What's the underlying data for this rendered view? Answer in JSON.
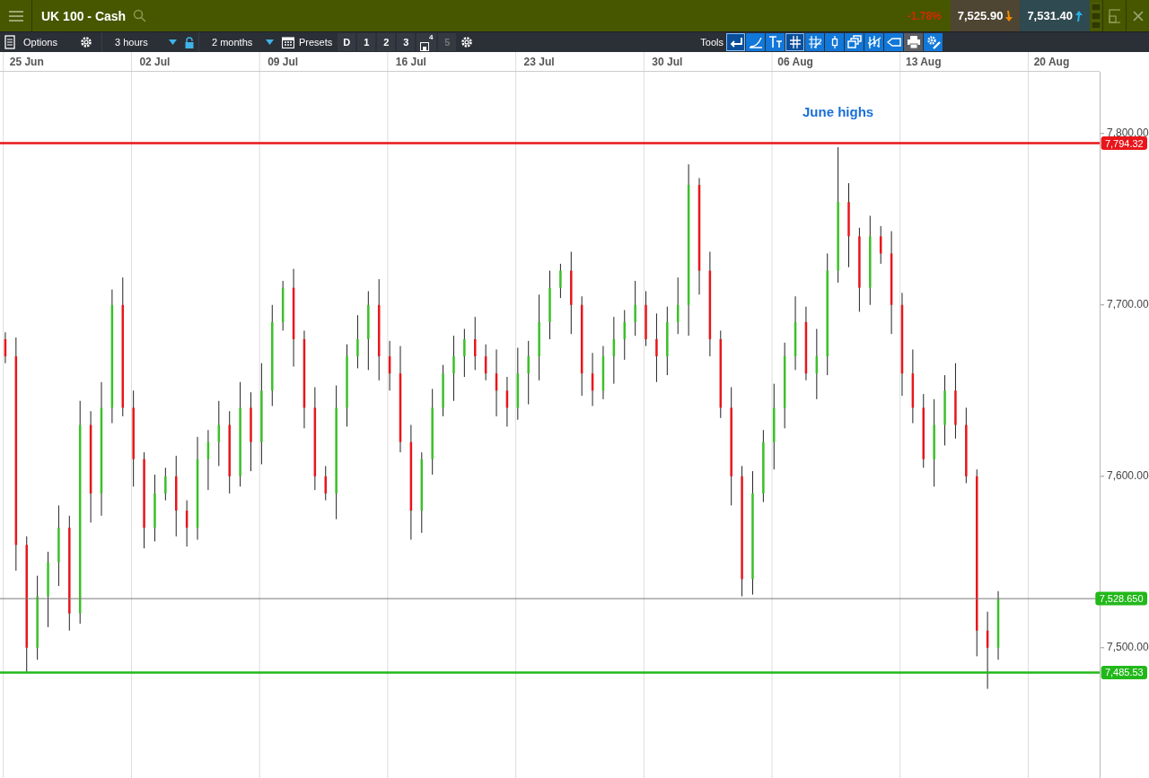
{
  "header": {
    "title": "UK 100 - Cash",
    "change": "-1.78%",
    "sell": {
      "price": "7,525.90"
    },
    "buy": {
      "price": "7,531.40"
    }
  },
  "toolbar": {
    "options_label": "Options",
    "interval": "3 hours",
    "range": "2 months",
    "presets_label": "Presets",
    "presets": [
      {
        "label": "D",
        "kind": "text",
        "disabled": false
      },
      {
        "label": "1",
        "kind": "text",
        "disabled": false
      },
      {
        "label": "2",
        "kind": "text",
        "disabled": false
      },
      {
        "label": "3",
        "kind": "text",
        "disabled": false
      },
      {
        "label": "4",
        "kind": "save",
        "disabled": false
      },
      {
        "label": "5",
        "kind": "text",
        "disabled": true
      }
    ],
    "tools_label": "Tools",
    "tools": [
      {
        "kind": "back",
        "selected": true
      },
      {
        "kind": "curve",
        "selected": false
      },
      {
        "kind": "text",
        "selected": false
      },
      {
        "kind": "parallel",
        "selected": true
      },
      {
        "kind": "grid-pen",
        "selected": false
      },
      {
        "kind": "candle",
        "selected": false
      },
      {
        "kind": "copy",
        "selected": false
      },
      {
        "kind": "bars",
        "selected": false
      },
      {
        "kind": "tag",
        "selected": false
      },
      {
        "kind": "print",
        "selected": false
      },
      {
        "kind": "settings",
        "selected": false
      }
    ]
  },
  "chart": {
    "chart_data": {
      "type": "candlestick",
      "ylim": [
        7424,
        7836
      ],
      "categories": [
        null,
        null,
        "25 Jun",
        null,
        null,
        null,
        null,
        null,
        null,
        null,
        null,
        null,
        null,
        null,
        "02 Jul",
        null,
        null,
        null,
        null,
        null,
        null,
        null,
        null,
        null,
        null,
        null,
        "09 Jul",
        null,
        null,
        null,
        null,
        null,
        null,
        null,
        null,
        null,
        null,
        null,
        "16 Jul",
        null,
        null,
        null,
        null,
        null,
        null,
        null,
        null,
        null,
        null,
        null,
        "23 Jul",
        null,
        null,
        null,
        null,
        null,
        null,
        null,
        null,
        null,
        null,
        null,
        "30 Jul",
        null,
        null,
        null,
        null,
        null,
        null,
        null,
        null,
        null,
        null,
        null,
        "06 Aug",
        null,
        null,
        null,
        null,
        null,
        null,
        null,
        null,
        null,
        null,
        null,
        "13 Aug",
        null,
        null,
        null,
        null,
        null,
        null,
        null,
        null,
        null,
        null,
        null,
        "20 Aug",
        null,
        null,
        null,
        null
      ],
      "yticks": [
        {
          "value": 7500,
          "label": "7,500.00"
        },
        {
          "value": 7600,
          "label": "7,600.00"
        },
        {
          "value": 7700,
          "label": "7,700.00"
        },
        {
          "value": 7800,
          "label": "7,800.00"
        }
      ],
      "ohlc": [
        [
          7680,
          7684,
          7666,
          7670
        ],
        [
          7670,
          7681,
          7545,
          7560
        ],
        [
          7560,
          7565,
          7486,
          7500
        ],
        [
          7500,
          7542,
          7493,
          7530
        ],
        [
          7530,
          7556,
          7512,
          7550
        ],
        [
          7550,
          7583,
          7536,
          7570
        ],
        [
          7570,
          7577,
          7510,
          7520
        ],
        [
          7520,
          7644,
          7514,
          7630
        ],
        [
          7630,
          7638,
          7573,
          7590
        ],
        [
          7590,
          7655,
          7577,
          7640
        ],
        [
          7640,
          7709,
          7631,
          7700
        ],
        [
          7700,
          7716,
          7635,
          7640
        ],
        [
          7640,
          7650,
          7594,
          7610
        ],
        [
          7610,
          7614,
          7558,
          7570
        ],
        [
          7570,
          7601,
          7562,
          7590
        ],
        [
          7590,
          7605,
          7586,
          7600
        ],
        [
          7600,
          7612,
          7565,
          7580
        ],
        [
          7580,
          7586,
          7559,
          7570
        ],
        [
          7570,
          7623,
          7563,
          7610
        ],
        [
          7610,
          7627,
          7592,
          7620
        ],
        [
          7620,
          7644,
          7606,
          7630
        ],
        [
          7630,
          7638,
          7590,
          7600
        ],
        [
          7600,
          7655,
          7594,
          7640
        ],
        [
          7640,
          7649,
          7603,
          7620
        ],
        [
          7620,
          7666,
          7607,
          7650
        ],
        [
          7650,
          7700,
          7641,
          7690
        ],
        [
          7690,
          7714,
          7685,
          7710
        ],
        [
          7710,
          7721,
          7664,
          7680
        ],
        [
          7680,
          7685,
          7628,
          7640
        ],
        [
          7640,
          7652,
          7592,
          7600
        ],
        [
          7600,
          7606,
          7586,
          7590
        ],
        [
          7590,
          7653,
          7575,
          7640
        ],
        [
          7640,
          7677,
          7629,
          7670
        ],
        [
          7670,
          7694,
          7663,
          7680
        ],
        [
          7680,
          7708,
          7662,
          7700
        ],
        [
          7700,
          7715,
          7656,
          7670
        ],
        [
          7670,
          7679,
          7650,
          7660
        ],
        [
          7660,
          7676,
          7614,
          7620
        ],
        [
          7620,
          7630,
          7563,
          7580
        ],
        [
          7580,
          7614,
          7567,
          7610
        ],
        [
          7610,
          7651,
          7601,
          7640
        ],
        [
          7640,
          7665,
          7635,
          7660
        ],
        [
          7660,
          7682,
          7644,
          7670
        ],
        [
          7670,
          7686,
          7658,
          7680
        ],
        [
          7680,
          7693,
          7662,
          7670
        ],
        [
          7670,
          7677,
          7656,
          7660
        ],
        [
          7660,
          7674,
          7635,
          7650
        ],
        [
          7650,
          7658,
          7629,
          7640
        ],
        [
          7640,
          7675,
          7633,
          7660
        ],
        [
          7660,
          7679,
          7642,
          7670
        ],
        [
          7670,
          7706,
          7656,
          7690
        ],
        [
          7690,
          7720,
          7680,
          7710
        ],
        [
          7710,
          7724,
          7704,
          7720
        ],
        [
          7720,
          7731,
          7683,
          7700
        ],
        [
          7700,
          7705,
          7647,
          7660
        ],
        [
          7660,
          7672,
          7641,
          7650
        ],
        [
          7650,
          7676,
          7645,
          7670
        ],
        [
          7670,
          7693,
          7654,
          7680
        ],
        [
          7680,
          7697,
          7668,
          7690
        ],
        [
          7690,
          7714,
          7682,
          7700
        ],
        [
          7700,
          7708,
          7676,
          7680
        ],
        [
          7680,
          7695,
          7655,
          7670
        ],
        [
          7670,
          7699,
          7659,
          7690
        ],
        [
          7690,
          7716,
          7683,
          7700
        ],
        [
          7700,
          7782,
          7682,
          7770
        ],
        [
          7770,
          7774,
          7706,
          7720
        ],
        [
          7720,
          7731,
          7670,
          7680
        ],
        [
          7680,
          7685,
          7634,
          7640
        ],
        [
          7640,
          7652,
          7583,
          7600
        ],
        [
          7600,
          7606,
          7530,
          7540
        ],
        [
          7540,
          7603,
          7531,
          7590
        ],
        [
          7590,
          7627,
          7585,
          7620
        ],
        [
          7620,
          7654,
          7604,
          7640
        ],
        [
          7640,
          7678,
          7628,
          7670
        ],
        [
          7670,
          7705,
          7662,
          7690
        ],
        [
          7690,
          7699,
          7656,
          7660
        ],
        [
          7660,
          7686,
          7645,
          7670
        ],
        [
          7670,
          7730,
          7659,
          7720
        ],
        [
          7720,
          7792,
          7713,
          7760
        ],
        [
          7760,
          7771,
          7722,
          7740
        ],
        [
          7740,
          7745,
          7696,
          7710
        ],
        [
          7710,
          7752,
          7700,
          7740
        ],
        [
          7740,
          7746,
          7724,
          7730
        ],
        [
          7730,
          7743,
          7683,
          7700
        ],
        [
          7700,
          7707,
          7647,
          7660
        ],
        [
          7660,
          7674,
          7631,
          7640
        ],
        [
          7640,
          7648,
          7605,
          7610
        ],
        [
          7610,
          7645,
          7594,
          7630
        ],
        [
          7630,
          7659,
          7618,
          7650
        ],
        [
          7650,
          7666,
          7622,
          7630
        ],
        [
          7630,
          7640,
          7596,
          7600
        ],
        [
          7600,
          7604,
          7495,
          7510
        ],
        [
          7510,
          7521,
          7476,
          7500
        ],
        [
          7500,
          7533,
          7493,
          7528.65
        ],
        null,
        null,
        null,
        null,
        null,
        null,
        null,
        null,
        null
      ],
      "ref_lines": [
        {
          "axis": "y",
          "value": 7794.32,
          "label": "7,794.32",
          "color": "#e8161b"
        },
        {
          "axis": "y",
          "value": 7528.65,
          "label": "7,528.650",
          "color": "#777777"
        },
        {
          "axis": "y",
          "value": 7485.53,
          "label": "7,485.53",
          "color": "#22b81a"
        }
      ],
      "annotations": [
        "June highs"
      ]
    }
  }
}
